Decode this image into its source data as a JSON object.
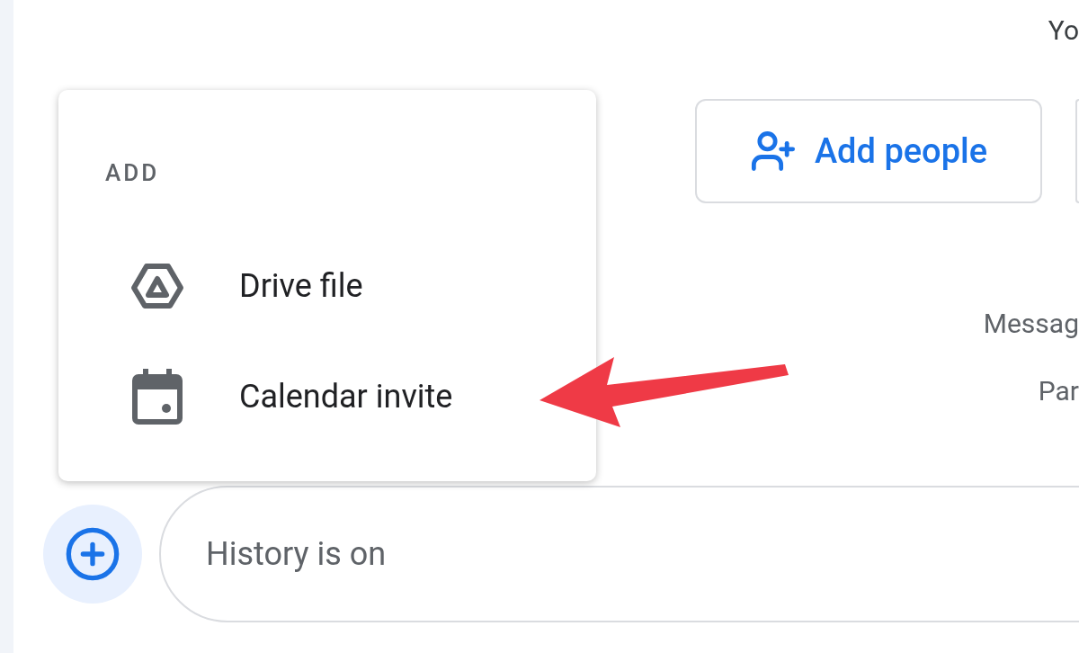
{
  "header": {
    "cut_text": "Yo"
  },
  "actions": {
    "add_people": "Add people"
  },
  "info": {
    "line_1": "Messag",
    "line_2": "Par"
  },
  "menu": {
    "title": "ADD",
    "items": [
      {
        "kind": "drive",
        "label": "Drive file"
      },
      {
        "kind": "calendar",
        "label": "Calendar invite"
      }
    ]
  },
  "composer": {
    "placeholder": "History is on"
  }
}
